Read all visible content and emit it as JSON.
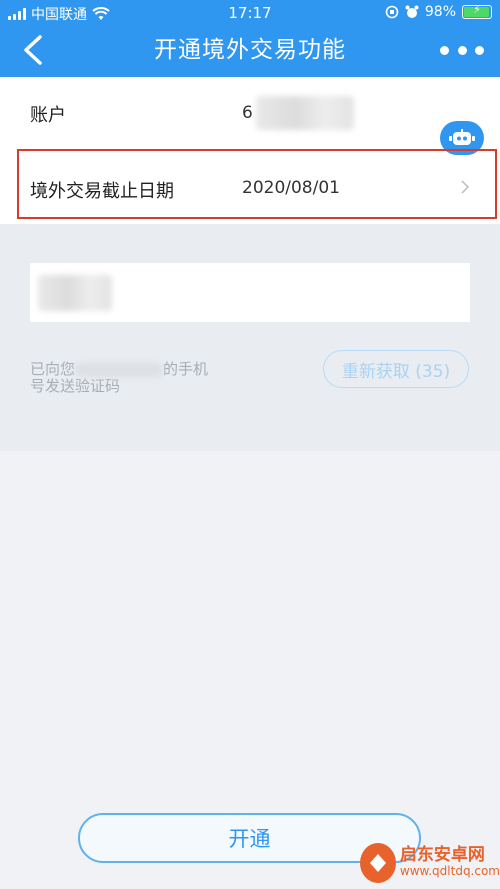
{
  "status_bar": {
    "carrier": "中国联通",
    "time": "17:17",
    "battery": "98%",
    "battery_level": 0.98
  },
  "header": {
    "title": "开通境外交易功能"
  },
  "account": {
    "label": "账户",
    "value_visible": "6"
  },
  "expiry": {
    "label": "境外交易截止日期",
    "value": "2020/08/01"
  },
  "verification": {
    "hint_line1": "已向您",
    "hint_line1_tail": "的手机",
    "hint_line2": "号发送验证码",
    "resend_label": "重新获取 (35)"
  },
  "actions": {
    "open_label": "开通"
  },
  "watermark": {
    "name": "启东安卓网",
    "url": "www.qdltdq.com"
  },
  "colors": {
    "brand_blue": "#2f97f0",
    "highlight_red": "#d93b2b",
    "watermark_orange": "#e8632b"
  }
}
